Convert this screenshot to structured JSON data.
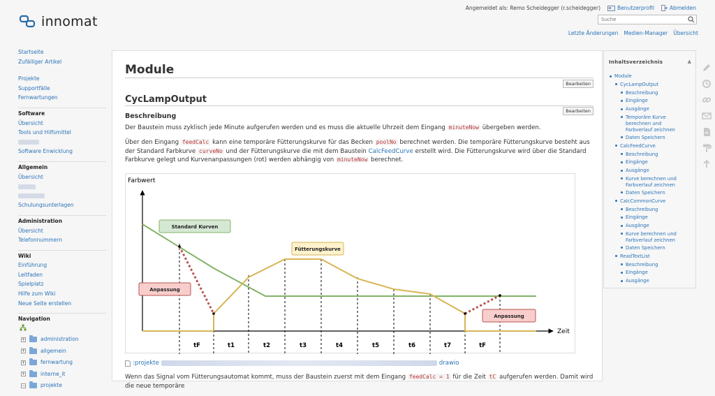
{
  "brand": {
    "name": "innomat"
  },
  "userbar": {
    "logged_in_label": "Angemeldet als: Remo Scheidegger (r.scheidegger)",
    "profile_link": "Benutzerprofil",
    "logout_link": "Abmelden"
  },
  "search": {
    "placeholder": "Suche"
  },
  "toplinks": [
    "Letzte Änderungen",
    "Medien-Manager",
    "Übersicht"
  ],
  "sidebar": {
    "nav1": [
      "Startseite",
      "Zufälliger Artikel"
    ],
    "nav2": [
      "Projekte",
      "Supportfälle",
      "Fernwartungen"
    ],
    "software": {
      "header": "Software",
      "items": [
        "Übersicht",
        "Tools und Hilfsmittel",
        "Software Enwicklung"
      ]
    },
    "allgemein": {
      "header": "Allgemein",
      "items": [
        "Übersicht",
        "Schulungsunterlagen"
      ]
    },
    "administration": {
      "header": "Administration",
      "items": [
        "Übersicht",
        "Telefonnummern"
      ]
    },
    "wiki": {
      "header": "Wiki",
      "items": [
        "Einführung",
        "Leitfaden",
        "Spielplatz",
        "Hilfe zum Wiki",
        "Neue Seite erstellen"
      ]
    },
    "navigation": {
      "header": "Navigation",
      "tree": [
        "administration",
        "allgemein",
        "fernwartung",
        "interne_it",
        "projekte"
      ]
    }
  },
  "page": {
    "title": "Module",
    "edit_label": "Bearbeiten",
    "section_title": "CycLampOutput",
    "subsection_title": "Beschreibung",
    "p1": {
      "a": "Der Baustein muss zyklisch jede Minute aufgerufen werden und es muss die aktuelle Uhrzeit dem Eingang ",
      "code1": "minuteNow",
      "b": " übergeben werden."
    },
    "p2": {
      "a": "Über den Eingang ",
      "code1": "feedCalc",
      "b": " kann eine temporäre Fütterungskurve für das Becken ",
      "code2": "poolNo",
      "c": " berechnet werden. Die temporäre Fütterungskurve besteht aus der Standard Farbkurve ",
      "code3": "curveNo",
      "d": " und der Fütterungskurve die mit dem Baustein ",
      "link": "CalcFeedCurve",
      "e": " erstellt wird. Die Fütterungskurve wird über die Standard Farbkurve gelegt und Kurvenanpassungen (rot) werden abhängig von ",
      "code4": "minuteNow",
      "f": " berechnet."
    },
    "file_link": {
      "prefix": ":projekte",
      "suffix": "drawio"
    },
    "p3": {
      "a": "Wenn das Signal vom Fütterungsautomat kommt, muss der Baustein zuerst mit dem Eingang ",
      "code1": "feedCalc = 1",
      "b": " für die Zeit ",
      "code2": "tC",
      "c": " aufgerufen werden. Damit wird die neue temporäre"
    }
  },
  "diagram": {
    "y_axis_label": "Farbwert",
    "x_axis_label": "Zeit",
    "boxes": {
      "standard": "Standard Kurven",
      "feed": "Fütterungskurve",
      "adjust_left": "Anpassung",
      "adjust_right": "Anpassung"
    },
    "intervals": [
      "tF",
      "t1",
      "t2",
      "t3",
      "t4",
      "t5",
      "t6",
      "t7",
      "tF"
    ],
    "colors": {
      "standard": "#82b366",
      "feed": "#d6b656",
      "adjust": "#b85450"
    }
  },
  "toc": {
    "header": "Inhaltsverzeichnis",
    "items": [
      {
        "level": 1,
        "label": "Module"
      },
      {
        "level": 2,
        "label": "CycLampOutput"
      },
      {
        "level": 3,
        "label": "Beschreibung"
      },
      {
        "level": 3,
        "label": "Eingänge"
      },
      {
        "level": 3,
        "label": "Ausgänge"
      },
      {
        "level": 3,
        "label": "Temporäre Kurve berechnen und Farbverlauf zeichnen"
      },
      {
        "level": 3,
        "label": "Daten Speichern"
      },
      {
        "level": 2,
        "label": "CalcFeedCurve"
      },
      {
        "level": 3,
        "label": "Beschreibung"
      },
      {
        "level": 3,
        "label": "Eingänge"
      },
      {
        "level": 3,
        "label": "Ausgänge"
      },
      {
        "level": 3,
        "label": "Kurve berechnen und Farbverlauf zeichnen"
      },
      {
        "level": 3,
        "label": "Daten Speichern"
      },
      {
        "level": 2,
        "label": "CalcCommonCurve"
      },
      {
        "level": 3,
        "label": "Beschreibung"
      },
      {
        "level": 3,
        "label": "Eingänge"
      },
      {
        "level": 3,
        "label": "Ausgänge"
      },
      {
        "level": 3,
        "label": "Kurve berechnen und Farbverlauf zeichnen"
      },
      {
        "level": 3,
        "label": "Daten Speichern"
      },
      {
        "level": 2,
        "label": "ReadTextList"
      },
      {
        "level": 3,
        "label": "Beschreibung"
      },
      {
        "level": 3,
        "label": "Eingänge"
      },
      {
        "level": 3,
        "label": "Ausgänge"
      }
    ]
  },
  "tools": [
    "pencil-icon",
    "history-icon",
    "link-icon",
    "mail-icon",
    "pdf-icon",
    "paint-roller-icon",
    "arrow-up-icon"
  ]
}
